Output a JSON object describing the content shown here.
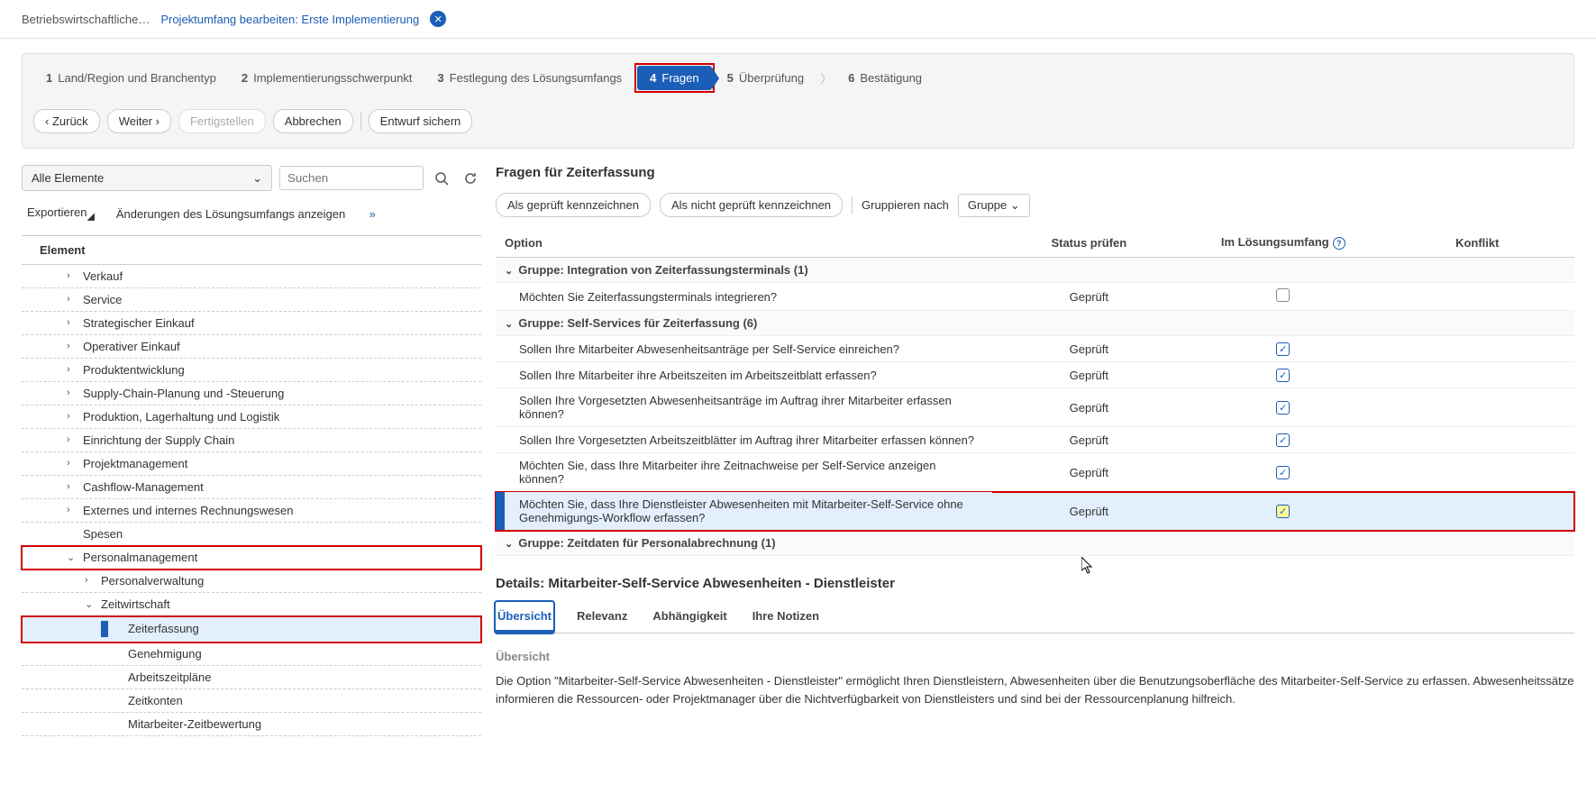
{
  "breadcrumb": {
    "parent": "Betriebswirtschaftliche…",
    "current": "Projektumfang bearbeiten: Erste Implementierung"
  },
  "wizard": {
    "steps": [
      {
        "num": "1",
        "label": "Land/Region und Branchentyp"
      },
      {
        "num": "2",
        "label": "Implementierungsschwerpunkt"
      },
      {
        "num": "3",
        "label": "Festlegung des Lösungsumfangs"
      },
      {
        "num": "4",
        "label": "Fragen"
      },
      {
        "num": "5",
        "label": "Überprüfung"
      },
      {
        "num": "6",
        "label": "Bestätigung"
      }
    ]
  },
  "actions": {
    "back": "Zurück",
    "next": "Weiter",
    "finish": "Fertigstellen",
    "cancel": "Abbrechen",
    "save_draft": "Entwurf sichern"
  },
  "left": {
    "filter_value": "Alle Elemente",
    "search_placeholder": "Suchen",
    "export": "Exportieren",
    "show_changes": "Änderungen des Lösungsumfangs anzeigen",
    "header": "Element",
    "tree": [
      {
        "label": "Verkauf",
        "indent": 1,
        "chev": "›"
      },
      {
        "label": "Service",
        "indent": 1,
        "chev": "›"
      },
      {
        "label": "Strategischer Einkauf",
        "indent": 1,
        "chev": "›"
      },
      {
        "label": "Operativer Einkauf",
        "indent": 1,
        "chev": "›"
      },
      {
        "label": "Produktentwicklung",
        "indent": 1,
        "chev": "›"
      },
      {
        "label": "Supply-Chain-Planung und -Steuerung",
        "indent": 1,
        "chev": "›"
      },
      {
        "label": "Produktion, Lagerhaltung und Logistik",
        "indent": 1,
        "chev": "›"
      },
      {
        "label": "Einrichtung der Supply Chain",
        "indent": 1,
        "chev": "›"
      },
      {
        "label": "Projektmanagement",
        "indent": 1,
        "chev": "›"
      },
      {
        "label": "Cashflow-Management",
        "indent": 1,
        "chev": "›"
      },
      {
        "label": "Externes und internes Rechnungswesen",
        "indent": 1,
        "chev": "›"
      },
      {
        "label": "Spesen",
        "indent": 1,
        "chev": ""
      },
      {
        "label": "Personalmanagement",
        "indent": 1,
        "chev": "⌄",
        "red": true
      },
      {
        "label": "Personalverwaltung",
        "indent": 2,
        "chev": "›"
      },
      {
        "label": "Zeitwirtschaft",
        "indent": 2,
        "chev": "⌄"
      },
      {
        "label": "Zeiterfassung",
        "indent": 3,
        "chev": "",
        "selected": true,
        "red": true
      },
      {
        "label": "Genehmigung",
        "indent": 3,
        "chev": ""
      },
      {
        "label": "Arbeitszeitpläne",
        "indent": 3,
        "chev": ""
      },
      {
        "label": "Zeitkonten",
        "indent": 3,
        "chev": ""
      },
      {
        "label": "Mitarbeiter-Zeitbewertung",
        "indent": 3,
        "chev": ""
      }
    ]
  },
  "right": {
    "title": "Fragen für Zeiterfassung",
    "mark_checked": "Als geprüft kennzeichnen",
    "mark_unchecked": "Als nicht geprüft kennzeichnen",
    "group_by_label": "Gruppieren nach",
    "group_by_value": "Gruppe",
    "columns": {
      "option": "Option",
      "status": "Status prüfen",
      "scope": "Im Lösungsumfang",
      "conflict": "Konflikt"
    },
    "groups": [
      {
        "title": "Gruppe: Integration von Zeiterfassungsterminals (1)",
        "rows": [
          {
            "q": "Möchten Sie Zeiterfassungsterminals integrieren?",
            "status": "Geprüft",
            "chk": "empty"
          }
        ]
      },
      {
        "title": "Gruppe: Self-Services für Zeiterfassung (6)",
        "rows": [
          {
            "q": "Sollen Ihre Mitarbeiter Abwesenheitsanträge per Self-Service einreichen?",
            "status": "Geprüft",
            "chk": "on"
          },
          {
            "q": "Sollen Ihre Mitarbeiter ihre Arbeitszeiten im Arbeitszeitblatt erfassen?",
            "status": "Geprüft",
            "chk": "on"
          },
          {
            "q": "Sollen Ihre Vorgesetzten Abwesenheitsanträge im Auftrag ihrer Mitarbeiter erfassen können?",
            "status": "Geprüft",
            "chk": "on"
          },
          {
            "q": "Sollen Ihre Vorgesetzten Arbeitszeitblätter im Auftrag ihrer Mitarbeiter erfassen können?",
            "status": "Geprüft",
            "chk": "on"
          },
          {
            "q": "Möchten Sie, dass Ihre Mitarbeiter ihre Zeitnachweise per Self-Service anzeigen können?",
            "status": "Geprüft",
            "chk": "on"
          },
          {
            "q": "Möchten Sie, dass Ihre Dienstleister Abwesenheiten mit Mitarbeiter-Self-Service ohne Genehmigungs-Workflow erfassen?",
            "status": "Geprüft",
            "chk": "hl",
            "selected": true,
            "red": true
          }
        ]
      },
      {
        "title": "Gruppe: Zeitdaten für Personalabrechnung (1)",
        "rows": []
      }
    ],
    "details_title": "Details: Mitarbeiter-Self-Service Abwesenheiten - Dienstleister",
    "tabs": [
      "Übersicht",
      "Relevanz",
      "Abhängigkeit",
      "Ihre Notizen"
    ],
    "overview_heading": "Übersicht",
    "overview_text": "Die Option \"Mitarbeiter-Self-Service Abwesenheiten - Dienstleister\" ermöglicht Ihren Dienstleistern, Abwesenheiten über die Benutzungsoberfläche des Mitarbeiter-Self-Service zu erfassen. Abwesenheitssätze informieren die Ressourcen- oder Projektmanager über die Nichtverfügbarkeit von Dienstleisters und sind bei der Ressourcenplanung hilfreich."
  }
}
